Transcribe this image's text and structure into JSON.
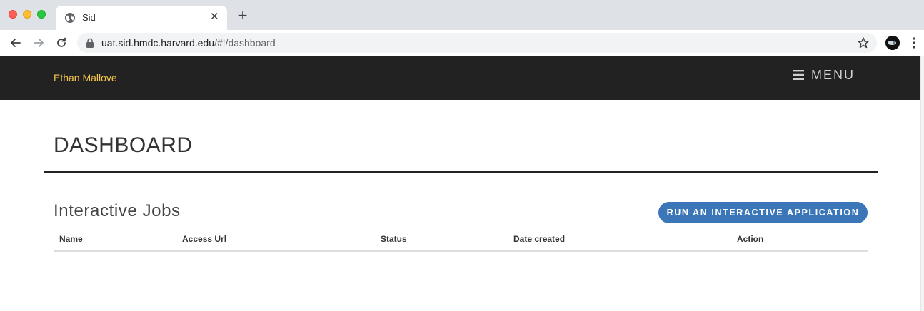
{
  "browser": {
    "tab_title": "Sid",
    "url_host": "uat.sid.hmdc.harvard.edu",
    "url_path": "/#!/dashboard"
  },
  "navbar": {
    "user_name": "Ethan Mallove",
    "menu_label": "MENU"
  },
  "page": {
    "title": "DASHBOARD"
  },
  "interactive_jobs": {
    "title": "Interactive Jobs",
    "run_button_label": "RUN AN INTERACTIVE APPLICATION",
    "columns": [
      "Name",
      "Access Url",
      "Status",
      "Date created",
      "Action"
    ],
    "rows": []
  },
  "colors": {
    "navbar_bg": "#222222",
    "user_name": "#f5c54c",
    "primary_button": "#3a76b8"
  }
}
